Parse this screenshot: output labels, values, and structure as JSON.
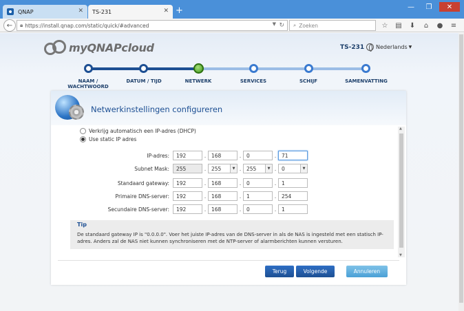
{
  "browser": {
    "tabs": [
      {
        "title": "QNAP",
        "close": "✕"
      },
      {
        "title": "TS-231",
        "close": "✕"
      }
    ],
    "new_tab": "+",
    "url": "https://install.qnap.com/static/quick/#advanced",
    "search_placeholder": "Zoeken",
    "window_buttons": [
      "—",
      "❐",
      "✕"
    ]
  },
  "header": {
    "brand": "myQNAPcloud",
    "device_name": "TS-231",
    "language": "Nederlands"
  },
  "wizard": {
    "steps": [
      {
        "label": "NAAM / WACHTWOORD",
        "state": "done"
      },
      {
        "label": "DATUM / TIJD",
        "state": "done"
      },
      {
        "label": "NETWERK",
        "state": "current"
      },
      {
        "label": "SERVICES",
        "state": "todo"
      },
      {
        "label": "SCHIJF",
        "state": "todo"
      },
      {
        "label": "SAMENVATTING",
        "state": "todo"
      }
    ]
  },
  "card": {
    "title": "Netwerkinstellingen configureren",
    "radio_dhcp": "Verkrijg automatisch een IP-adres (DHCP)",
    "radio_static": "Use static IP adres",
    "selected": "static"
  },
  "fields": {
    "ip": {
      "label": "IP-adres:",
      "values": [
        "192",
        "168",
        "0",
        "71"
      ]
    },
    "mask": {
      "label": "Subnet Mask:",
      "values": [
        "255",
        "255",
        "255",
        "0"
      ]
    },
    "gateway": {
      "label": "Standaard gateway:",
      "values": [
        "192",
        "168",
        "0",
        "1"
      ]
    },
    "dns1": {
      "label": "Primaire DNS-server:",
      "values": [
        "192",
        "168",
        "1",
        "254"
      ]
    },
    "dns2": {
      "label": "Secundaire DNS-server:",
      "values": [
        "192",
        "168",
        "0",
        "1"
      ]
    }
  },
  "tip": {
    "title": "Tip",
    "text": "De standaard gateway IP is \"0.0.0.0\". Voer het juiste IP-adres van de DNS-server in als de NAS is ingesteld met een statisch IP-adres. Anders zal de NAS niet kunnen synchroniseren met de NTP-server of alarmberichten kunnen versturen."
  },
  "buttons": {
    "back": "Terug",
    "next": "Volgende",
    "cancel": "Annuleren"
  },
  "colors": {
    "titlebar": "#4a90d9",
    "primary": "#1d4f93",
    "cancel": "#4aa0d6",
    "current_step": "#3f9a1e"
  }
}
